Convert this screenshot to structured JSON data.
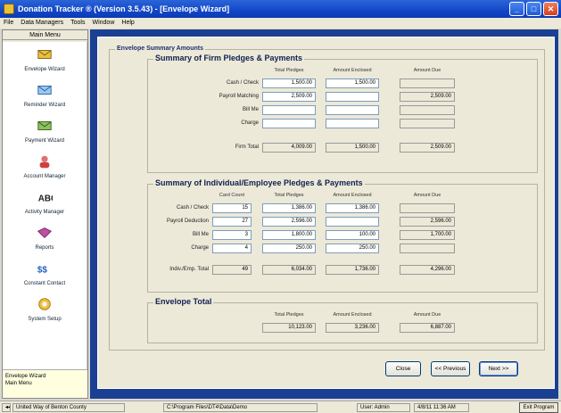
{
  "window": {
    "title": "Donation Tracker ® (Version 3.5.43) - [Envelope Wizard]",
    "min_icon": "minimize-icon",
    "max_icon": "maximize-icon",
    "close_icon": "close-icon"
  },
  "menu": [
    "File",
    "Data Managers",
    "Tools",
    "Window",
    "Help"
  ],
  "sidebar": {
    "header": "Main Menu",
    "items": [
      {
        "label": "Envelope Wizard",
        "icon": "envelope-icon",
        "color": "#e8c040"
      },
      {
        "label": "Reminder Wizard",
        "icon": "reminder-icon",
        "color": "#5aa0e0"
      },
      {
        "label": "Payment Wizard",
        "icon": "payment-icon",
        "color": "#60a040"
      },
      {
        "label": "Account Manager",
        "icon": "account-icon",
        "color": "#d04040"
      },
      {
        "label": "Activity Manager",
        "icon": "activity-icon",
        "color": "#202020"
      },
      {
        "label": "Reports",
        "icon": "reports-icon",
        "color": "#c050a0"
      },
      {
        "label": "Constant Contact",
        "icon": "constant-contact-icon",
        "color": "#2060c0"
      },
      {
        "label": "System Setup",
        "icon": "system-setup-icon",
        "color": "#e0a020"
      }
    ],
    "footer_line1": "Envelope Wizard",
    "footer_line2": "Main Menu"
  },
  "outer_legend": "Envelope Summary Amounts",
  "firm": {
    "legend": "Summary of Firm Pledges & Payments",
    "col_total": "Total Pledges",
    "col_enclosed": "Amount Enclosed",
    "col_due": "Amount Due",
    "rows": [
      {
        "label": "Cash / Check",
        "total": "1,500.00",
        "enclosed": "1,500.00",
        "due": ""
      },
      {
        "label": "Payroll Matching",
        "total": "2,509.00",
        "enclosed": "",
        "due": "2,509.00"
      },
      {
        "label": "Bill Me",
        "total": "",
        "enclosed": "",
        "due": ""
      },
      {
        "label": "Charge",
        "total": "",
        "enclosed": "",
        "due": ""
      }
    ],
    "total_label": "Firm Total",
    "total": {
      "total": "4,009.00",
      "enclosed": "1,500.00",
      "due": "2,509.00"
    }
  },
  "indiv": {
    "legend": "Summary of Individual/Employee Pledges & Payments",
    "col_count": "Card Count",
    "col_total": "Total Pledges",
    "col_enclosed": "Amount Enclosed",
    "col_due": "Amount Due",
    "rows": [
      {
        "label": "Cash / Check",
        "count": "15",
        "total": "1,386.00",
        "enclosed": "1,386.00",
        "due": ""
      },
      {
        "label": "Payroll Deduction",
        "count": "27",
        "total": "2,596.00",
        "enclosed": "",
        "due": "2,596.00"
      },
      {
        "label": "Bill Me",
        "count": "3",
        "total": "1,800.00",
        "enclosed": "100.00",
        "due": "1,700.00"
      },
      {
        "label": "Charge",
        "count": "4",
        "total": "250.00",
        "enclosed": "250.00",
        "due": ""
      }
    ],
    "total_label": "Indiv./Emp. Total",
    "total": {
      "count": "49",
      "total": "6,034.00",
      "enclosed": "1,736.00",
      "due": "4,296.00"
    }
  },
  "envelope": {
    "legend": "Envelope Total",
    "col_total": "Total Pledges",
    "col_enclosed": "Amount Enclosed",
    "col_due": "Amount Due",
    "total": "10,123.00",
    "enclosed": "3,236.00",
    "due": "6,887.00"
  },
  "buttons": {
    "close": "Close",
    "previous": "<< Previous",
    "next": "Next >>"
  },
  "status": {
    "org": "United Way of Benton County",
    "path": "C:\\Program Files\\DT4\\Data\\Demo",
    "user": "User: Admin",
    "datetime": "4/8/11 11:36 AM",
    "exit": "Exit Program"
  }
}
